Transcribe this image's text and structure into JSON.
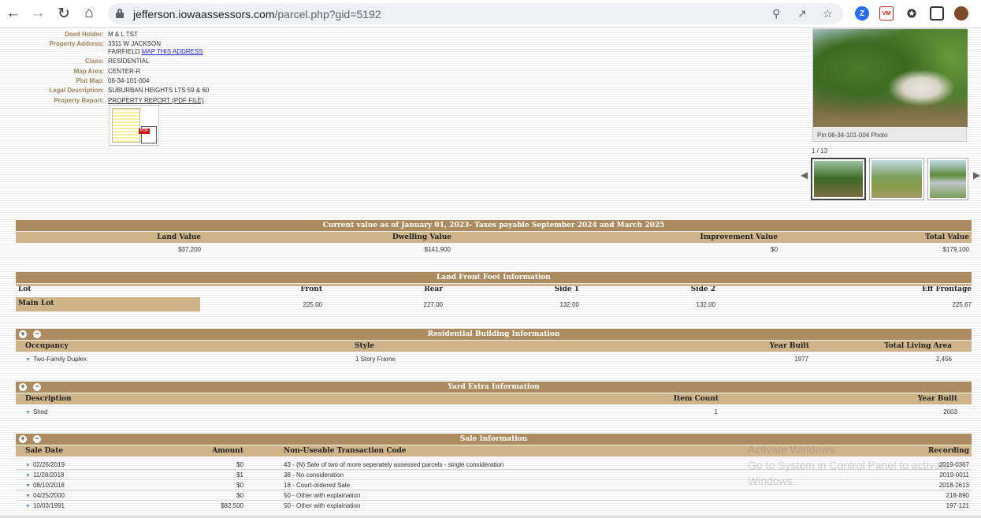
{
  "browser": {
    "url_host": "jefferson.iowaassessors.com",
    "url_path": "/parcel.php?gid=5192"
  },
  "parcel": {
    "labels": {
      "deed_holder": "Deed Holder:",
      "property_address": "Property Address:",
      "class": "Class:",
      "map_area": "Map Area:",
      "plat_map": "Plat Map:",
      "legal_description": "Legal Description:",
      "property_report": "Property Report:"
    },
    "deed_holder": "M & L TST",
    "address_line1": "3311 W JACKSON",
    "address_city": "FAIRFIELD",
    "map_link": "MAP THIS ADDRESS",
    "class": "RESIDENTIAL",
    "map_area": "CENTER-R",
    "plat_map": "06-34-101-004",
    "legal_description": "SUBURBAN HEIGHTS LTS 59 & 60",
    "report_link": "PROPERTY REPORT (PDF FILE)",
    "pdf_tag": "PDF"
  },
  "photo": {
    "caption": "Pin 06-34-101-004 Photo",
    "counter": "1 / 13"
  },
  "current_value": {
    "title": "Current value as of January 01, 2023- Taxes payable September 2024 and March 2025",
    "headers": [
      "Land Value",
      "Dwelling Value",
      "Improvement Value",
      "Total Value"
    ],
    "values": [
      "$37,200",
      "$141,900",
      "$0",
      "$179,100"
    ]
  },
  "land_front": {
    "title": "Land Front Foot Information",
    "headers": [
      "Lot",
      "Front",
      "Rear",
      "Side 1",
      "Side 2",
      "Eff Frontage"
    ],
    "row_label": "Main Lot",
    "values": [
      "225.00",
      "227.00",
      "132.00",
      "132.00",
      "225.67"
    ]
  },
  "residential": {
    "title": "Residential Building Information",
    "headers": [
      "Occupancy",
      "Style",
      "Year Built",
      "Total Living Area"
    ],
    "row": [
      "Two-Family Duplex",
      "1 Story Frame",
      "1977",
      "2,456"
    ]
  },
  "yard": {
    "title": "Yard Extra Information",
    "headers": [
      "Description",
      "Item Count",
      "Year Built"
    ],
    "row": [
      "Shed",
      "1",
      "2003"
    ]
  },
  "sales": {
    "title": "Sale Information",
    "headers": [
      "Sale Date",
      "Amount",
      "Non-Useable Transaction Code",
      "Recording"
    ],
    "rows": [
      [
        "02/26/2019",
        "$0",
        "43 - (N) Sale of two of more seperately assessed parcels - single consideration",
        "2019-0367"
      ],
      [
        "11/28/2018",
        "$1",
        "38 - No consideration",
        "2019-0011"
      ],
      [
        "08/10/2018",
        "$0",
        "18 - Court-ordered Sale",
        "2018-2613"
      ],
      [
        "04/25/2000",
        "$0",
        "50 - Other with explaination",
        "218-890"
      ],
      [
        "10/03/1991",
        "$82,500",
        "50 - Other with explaination",
        "197-121"
      ]
    ]
  },
  "watermark": {
    "line1": "Activate Windows",
    "line2": "Go to System in Control Panel to activate",
    "line3": "Windows."
  }
}
